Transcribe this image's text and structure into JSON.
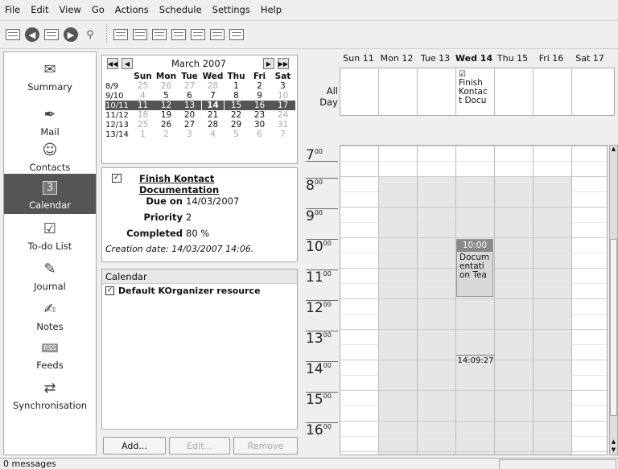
{
  "menu": [
    "File",
    "Edit",
    "View",
    "Go",
    "Actions",
    "Schedule",
    "Settings",
    "Help"
  ],
  "sidebar": {
    "items": [
      {
        "label": "Summary",
        "icon": "summary-icon"
      },
      {
        "label": "Mail",
        "icon": "mail-icon"
      },
      {
        "label": "Contacts",
        "icon": "contacts-icon"
      },
      {
        "label": "Calendar",
        "icon": "calendar-icon",
        "badge": "3"
      },
      {
        "label": "To-do List",
        "icon": "todo-icon"
      },
      {
        "label": "Journal",
        "icon": "journal-icon"
      },
      {
        "label": "Notes",
        "icon": "notes-icon"
      },
      {
        "label": "Feeds",
        "icon": "feeds-icon",
        "badge": "RSS"
      },
      {
        "label": "Synchronisation",
        "icon": "sync-icon"
      }
    ]
  },
  "minical": {
    "title": "March 2007",
    "weekdays": [
      "Sun",
      "Mon",
      "Tue",
      "Wed",
      "Thu",
      "Fri",
      "Sat"
    ],
    "weeks": [
      {
        "wk": "8/9",
        "days": [
          "25",
          "26",
          "27",
          "28",
          "1",
          "2",
          "3"
        ]
      },
      {
        "wk": "9/10",
        "days": [
          "4",
          "5",
          "6",
          "7",
          "8",
          "9",
          "10"
        ]
      },
      {
        "wk": "10/11",
        "days": [
          "11",
          "12",
          "13",
          "14",
          "15",
          "16",
          "17"
        ]
      },
      {
        "wk": "11/12",
        "days": [
          "18",
          "19",
          "20",
          "21",
          "22",
          "23",
          "24"
        ]
      },
      {
        "wk": "12/13",
        "days": [
          "25",
          "26",
          "27",
          "28",
          "29",
          "30",
          "31"
        ]
      },
      {
        "wk": "13/14",
        "days": [
          "1",
          "2",
          "3",
          "4",
          "5",
          "6",
          "7"
        ]
      }
    ]
  },
  "todo": {
    "title": "Finish Kontact Documentation",
    "due_label": "Due on",
    "due_value": "14/03/2007",
    "priority_label": "Priority",
    "priority_value": "2",
    "completed_label": "Completed",
    "completed_value": "80 %",
    "creation": "Creation date: 14/03/2007 14:06."
  },
  "resources": {
    "header": "Calendar",
    "items": [
      "Default KOrganizer resource"
    ]
  },
  "buttons": {
    "add": "Add...",
    "edit": "Edit...",
    "remove": "Remove"
  },
  "agenda": {
    "days": [
      "Sun 11",
      "Mon 12",
      "Tue 13",
      "Wed 14",
      "Thu 15",
      "Fri 16",
      "Sat 17"
    ],
    "allday_label": "All\nDay",
    "allday_event": "Finish Kontac t Docu",
    "hours": [
      "7",
      "8",
      "9",
      "10",
      "11",
      "12",
      "13",
      "14",
      "15",
      "16"
    ],
    "hour_suffix": "00",
    "event_time": "10:00",
    "event_text": "Docum entati on Tea",
    "current_time": "14:09:27"
  },
  "status": {
    "text": "0 messages"
  }
}
